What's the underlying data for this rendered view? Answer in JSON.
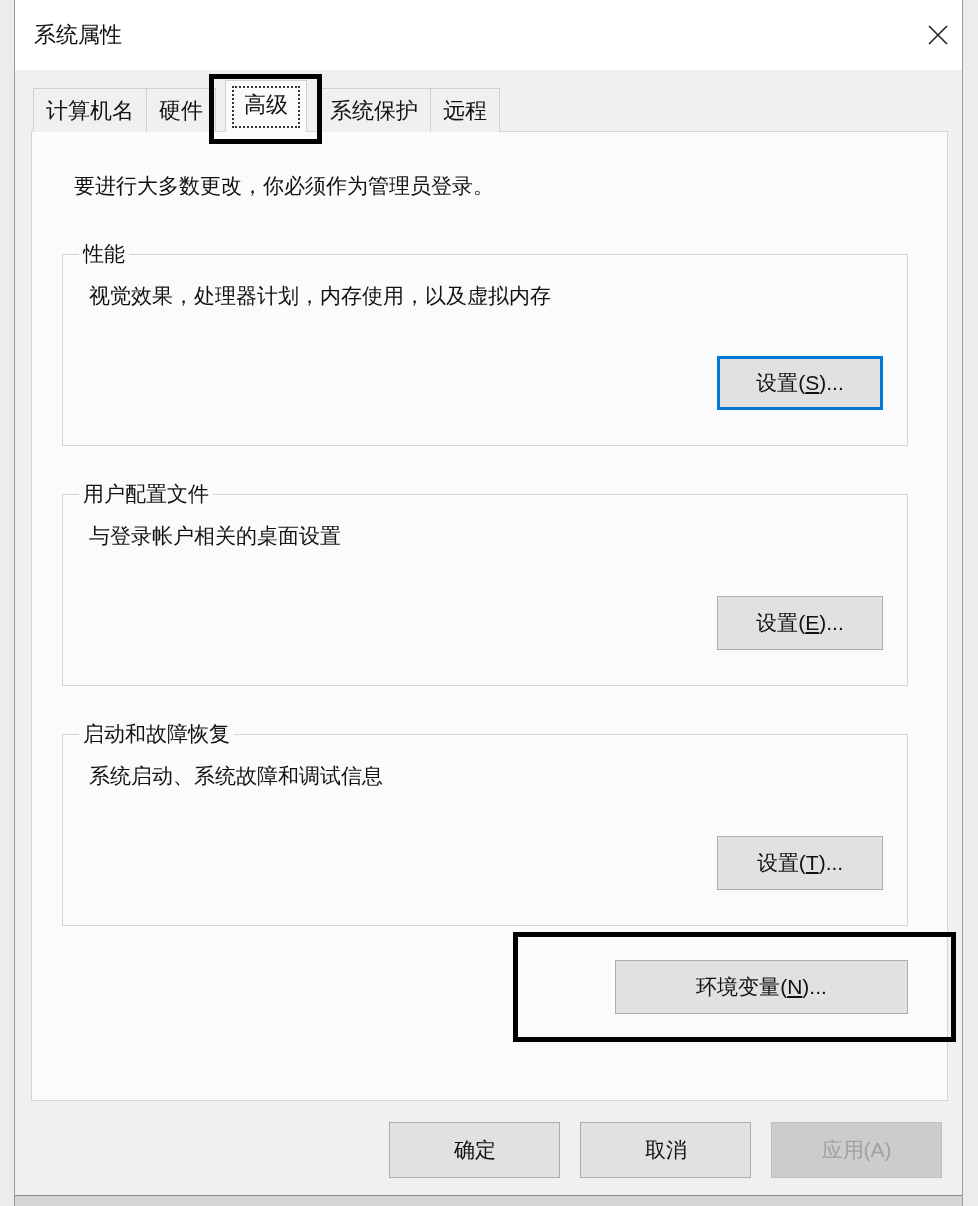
{
  "window": {
    "title": "系统属性"
  },
  "tabs": [
    {
      "label": "计算机名",
      "selected": false,
      "highlighted": false
    },
    {
      "label": "硬件",
      "selected": false,
      "highlighted": false
    },
    {
      "label": "高级",
      "selected": true,
      "highlighted": true
    },
    {
      "label": "系统保护",
      "selected": false,
      "highlighted": false
    },
    {
      "label": "远程",
      "selected": false,
      "highlighted": false
    }
  ],
  "notice": "要进行大多数更改，你必须作为管理员登录。",
  "groups": [
    {
      "title": "性能",
      "description": "视觉效果，处理器计划，内存使用，以及虚拟内存",
      "button": {
        "before": "设置(",
        "key": "S",
        "after": ")...",
        "focused": true
      }
    },
    {
      "title": "用户配置文件",
      "description": "与登录帐户相关的桌面设置",
      "button": {
        "before": "设置(",
        "key": "E",
        "after": ")...",
        "focused": false
      }
    },
    {
      "title": "启动和故障恢复",
      "description": "系统启动、系统故障和调试信息",
      "button": {
        "before": "设置(",
        "key": "T",
        "after": ")...",
        "focused": false
      }
    }
  ],
  "environment_button": {
    "before": "环境变量(",
    "key": "N",
    "after": ")...",
    "highlighted": true
  },
  "buttons": [
    {
      "label": "确定",
      "disabled": false
    },
    {
      "label": "取消",
      "disabled": false
    },
    {
      "label": "应用(A)",
      "disabled": true
    }
  ]
}
